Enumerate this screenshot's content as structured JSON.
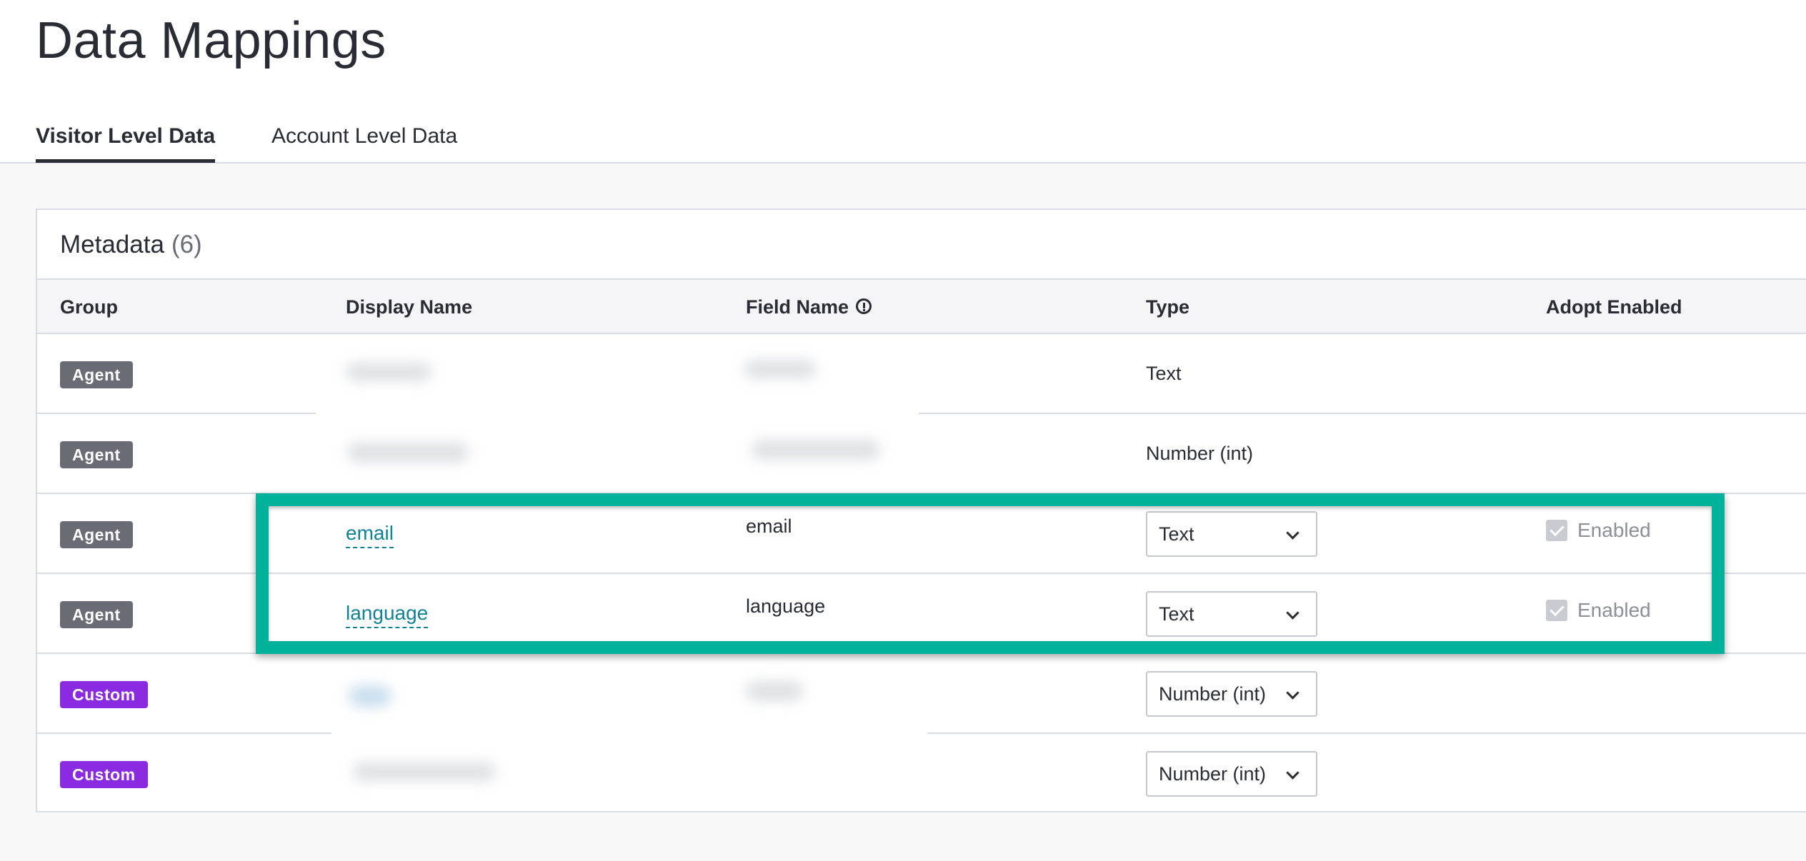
{
  "page": {
    "title": "Data Mappings"
  },
  "tabs": [
    {
      "label": "Visitor Level Data",
      "active": true
    },
    {
      "label": "Account Level Data",
      "active": false
    }
  ],
  "card": {
    "title": "Metadata",
    "count": "(6)"
  },
  "table": {
    "headers": {
      "group": "Group",
      "display_name": "Display Name",
      "field_name": "Field Name",
      "type": "Type",
      "adopt_enabled": "Adopt Enabled"
    },
    "rows": [
      {
        "group": "Agent",
        "display_name": "",
        "field_name": "",
        "type": "Text",
        "adopt_enabled": ""
      },
      {
        "group": "Agent",
        "display_name": "",
        "field_name": "",
        "type": "Number (int)",
        "adopt_enabled": ""
      },
      {
        "group": "Agent",
        "display_name": "email",
        "field_name": "email",
        "type": "Text",
        "adopt_enabled": "Enabled"
      },
      {
        "group": "Agent",
        "display_name": "language",
        "field_name": "language",
        "type": "Text",
        "adopt_enabled": "Enabled"
      },
      {
        "group": "Custom",
        "display_name": "",
        "field_name": "",
        "type": "Number (int)",
        "adopt_enabled": ""
      },
      {
        "group": "Custom",
        "display_name": "",
        "field_name": "",
        "type": "Number (int)",
        "adopt_enabled": ""
      }
    ]
  },
  "colors": {
    "agent_badge": "#6a6c75",
    "custom_badge": "#8a2be2",
    "link": "#128297",
    "highlight_border": "#00b29a"
  },
  "icons": {
    "field_name_info": "info-circle-icon",
    "select_chevron": "chevron-down-icon",
    "checkbox": "checkmark-icon"
  }
}
